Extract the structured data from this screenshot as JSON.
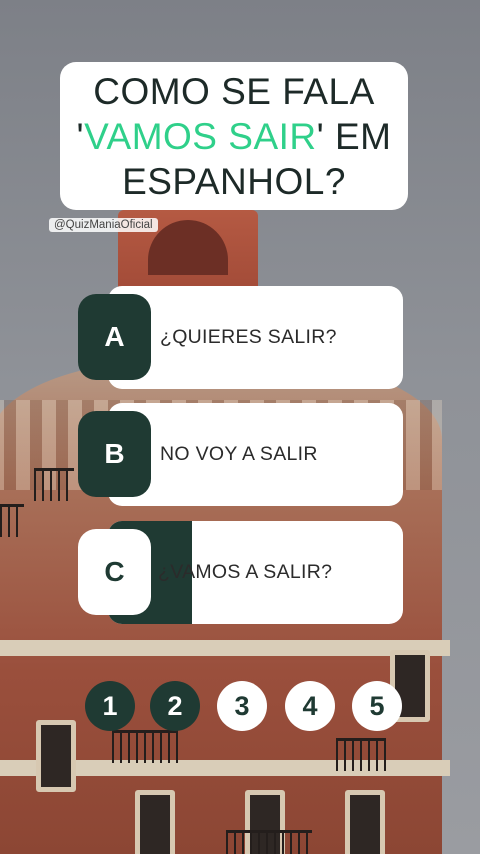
{
  "question": {
    "prefix": "COMO SE FALA",
    "quote_open": "'",
    "highlight": "VAMOS SAIR",
    "quote_close": "' EM",
    "line3": "ESPANHOL?"
  },
  "watermark": "@QuizManiaOficial",
  "options": [
    {
      "letter": "A",
      "text": "¿QUIERES SALIR?"
    },
    {
      "letter": "B",
      "text": "NO VOY A SALIR"
    },
    {
      "letter": "C",
      "text": "¿VAMOS A SALIR?"
    }
  ],
  "timer": {
    "steps": [
      "1",
      "2",
      "3",
      "4",
      "5"
    ],
    "completed": 2
  },
  "colors": {
    "accent_dark": "#1f3a33",
    "highlight_green": "#2fd08a",
    "card": "#ffffff"
  }
}
